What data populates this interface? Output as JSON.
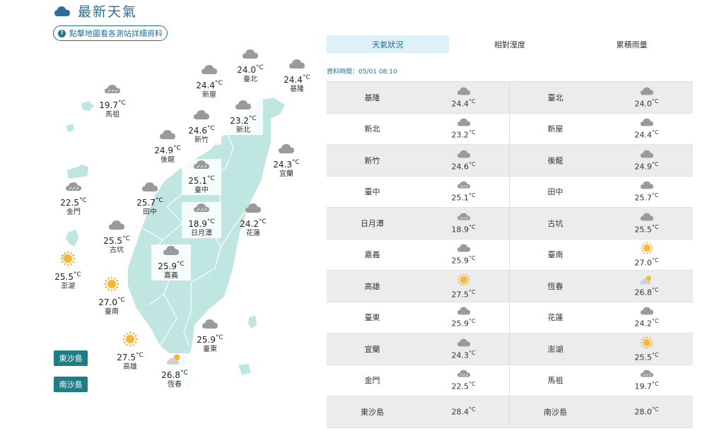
{
  "header": {
    "title": "最新天氣",
    "map_hint": "點擊地圖看各測站詳細資料"
  },
  "tabs": [
    {
      "label": "天氣狀況",
      "active": true
    },
    {
      "label": "相對溼度",
      "active": false
    },
    {
      "label": "累積雨量",
      "active": false
    }
  ],
  "data_time": "資料時間：05/01 08:10",
  "unit": "°C",
  "map_stations": [
    {
      "name": "臺北",
      "temp": "24.0",
      "icon": "cloudy-icon"
    },
    {
      "name": "基隆",
      "temp": "24.4",
      "icon": "cloudy-icon"
    },
    {
      "name": "新屋",
      "temp": "24.4",
      "icon": "cloudy-icon"
    },
    {
      "name": "馬祖",
      "temp": "19.7",
      "icon": "rain-cloud-icon"
    },
    {
      "name": "新北",
      "temp": "23.2",
      "icon": "cloudy-icon"
    },
    {
      "name": "新竹",
      "temp": "24.6",
      "icon": "cloudy-icon"
    },
    {
      "name": "後龍",
      "temp": "24.9",
      "icon": "cloudy-icon"
    },
    {
      "name": "宜蘭",
      "temp": "24.3",
      "icon": "cloudy-icon"
    },
    {
      "name": "臺中",
      "temp": "25.1",
      "icon": "rain-cloud-icon"
    },
    {
      "name": "金門",
      "temp": "22.5",
      "icon": "rain-cloud-icon"
    },
    {
      "name": "田中",
      "temp": "25.7",
      "icon": "cloudy-icon"
    },
    {
      "name": "日月潭",
      "temp": "18.9",
      "icon": "rain-cloud-icon"
    },
    {
      "name": "花蓮",
      "temp": "24.2",
      "icon": "cloudy-icon"
    },
    {
      "name": "古坑",
      "temp": "25.5",
      "icon": "cloudy-icon"
    },
    {
      "name": "澎湖",
      "temp": "25.5",
      "icon": "sun-icon"
    },
    {
      "name": "嘉義",
      "temp": "25.9",
      "icon": "cloudy-icon"
    },
    {
      "name": "臺南",
      "temp": "27.0",
      "icon": "sun-icon"
    },
    {
      "name": "臺東",
      "temp": "25.9",
      "icon": "cloudy-icon"
    },
    {
      "name": "高雄",
      "temp": "27.5",
      "icon": "sun-icon"
    },
    {
      "name": "恆春",
      "temp": "26.8",
      "icon": "partly-cloudy-icon"
    }
  ],
  "island_buttons": [
    "東沙島",
    "南沙島"
  ],
  "table_rows": [
    {
      "left": {
        "name": "基隆",
        "temp": "24.4",
        "icon": "cloudy-icon"
      },
      "right": {
        "name": "臺北",
        "temp": "24.0",
        "icon": "cloudy-icon"
      }
    },
    {
      "left": {
        "name": "新北",
        "temp": "23.2",
        "icon": "cloudy-icon"
      },
      "right": {
        "name": "新屋",
        "temp": "24.4",
        "icon": "cloudy-icon"
      }
    },
    {
      "left": {
        "name": "新竹",
        "temp": "24.6",
        "icon": "cloudy-icon"
      },
      "right": {
        "name": "後龍",
        "temp": "24.9",
        "icon": "cloudy-icon"
      }
    },
    {
      "left": {
        "name": "臺中",
        "temp": "25.1",
        "icon": "rain-cloud-icon"
      },
      "right": {
        "name": "田中",
        "temp": "25.7",
        "icon": "cloudy-icon"
      }
    },
    {
      "left": {
        "name": "日月潭",
        "temp": "18.9",
        "icon": "rain-cloud-icon"
      },
      "right": {
        "name": "古坑",
        "temp": "25.5",
        "icon": "cloudy-icon"
      }
    },
    {
      "left": {
        "name": "嘉義",
        "temp": "25.9",
        "icon": "cloudy-icon"
      },
      "right": {
        "name": "臺南",
        "temp": "27.0",
        "icon": "sun-icon"
      }
    },
    {
      "left": {
        "name": "高雄",
        "temp": "27.5",
        "icon": "sun-icon"
      },
      "right": {
        "name": "恆春",
        "temp": "26.8",
        "icon": "partly-cloudy-icon"
      }
    },
    {
      "left": {
        "name": "臺東",
        "temp": "25.9",
        "icon": "cloudy-icon"
      },
      "right": {
        "name": "花蓮",
        "temp": "24.2",
        "icon": "cloudy-icon"
      }
    },
    {
      "left": {
        "name": "宜蘭",
        "temp": "24.3",
        "icon": "cloudy-icon"
      },
      "right": {
        "name": "澎湖",
        "temp": "25.5",
        "icon": "sun-icon"
      }
    },
    {
      "left": {
        "name": "金門",
        "temp": "22.5",
        "icon": "rain-cloud-icon"
      },
      "right": {
        "name": "馬祖",
        "temp": "19.7",
        "icon": "rain-cloud-icon"
      }
    },
    {
      "left": {
        "name": "東沙島",
        "temp": "28.4",
        "icon": ""
      },
      "right": {
        "name": "南沙島",
        "temp": "28.0",
        "icon": ""
      }
    }
  ],
  "colors": {
    "accent": "#2a6f97",
    "map_fill": "#bfe6e0",
    "button": "#1f7d85",
    "tab_active": "#dff1f8"
  }
}
